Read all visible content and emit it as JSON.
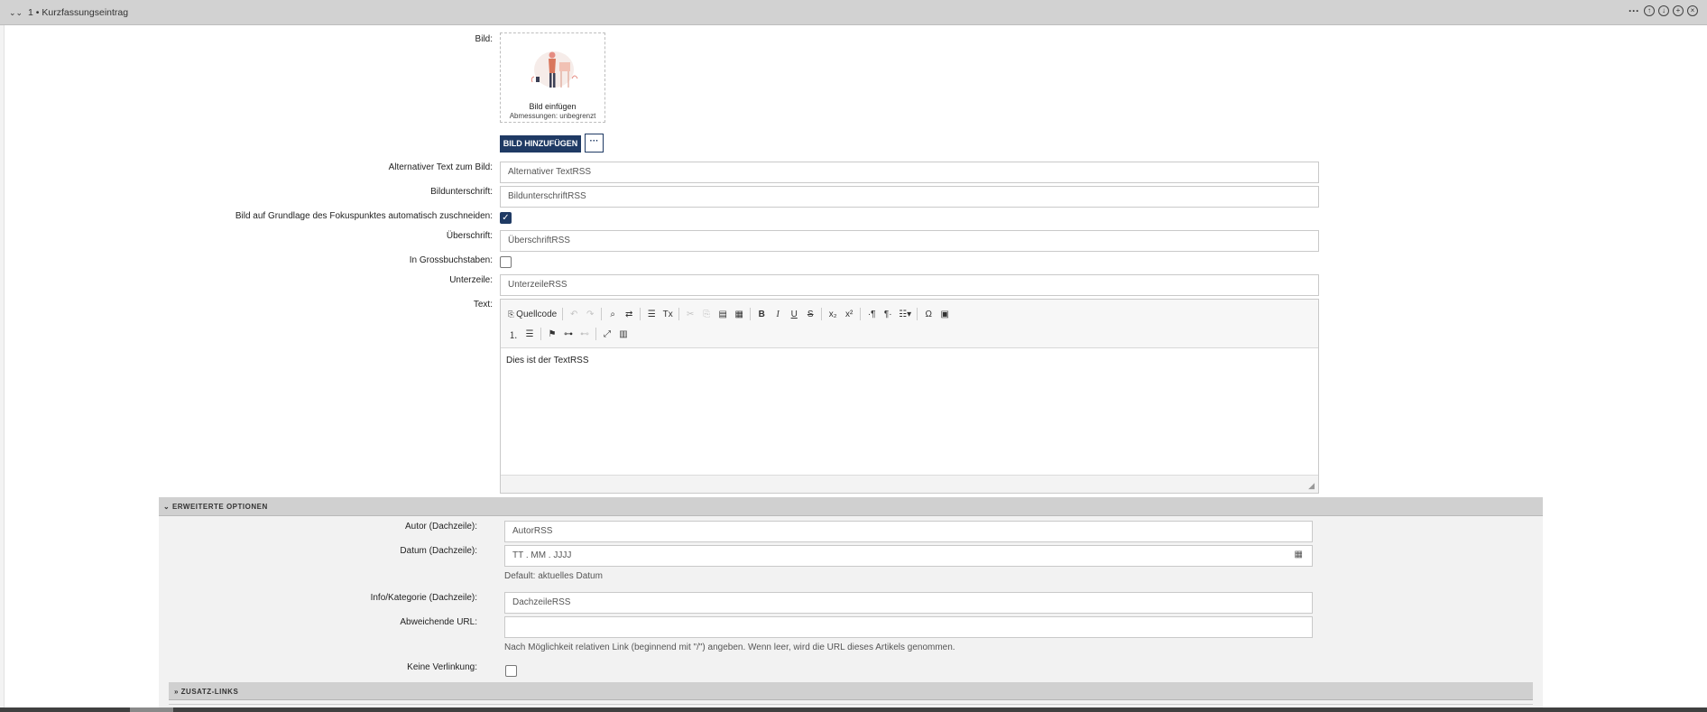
{
  "header": {
    "title": "1 • Kurzfassungseintrag",
    "actions": [
      "more-icon",
      "move-up-icon",
      "move-down-icon",
      "add-icon",
      "close-icon"
    ]
  },
  "form": {
    "bild_label": "Bild:",
    "image_caption": "Bild einfügen",
    "image_dimensions": "Abmessungen: unbegrenzt",
    "add_image_button": "BILD HINZUFÜGEN",
    "more_button": "···",
    "alt_label": "Alternativer Text zum Bild:",
    "alt_value": "Alternativer TextRSS",
    "caption_label": "Bildunterschrift:",
    "caption_value": "BildunterschriftRSS",
    "crop_label": "Bild auf Grundlage des Fokuspunktes automatisch zuschneiden:",
    "crop_checked": true,
    "heading_label": "Überschrift:",
    "heading_value": "ÜberschriftRSS",
    "caps_label": "In Grossbuchstaben:",
    "caps_checked": false,
    "subline_label": "Unterzeile:",
    "subline_value": "UnterzeileRSS",
    "text_label": "Text:",
    "editor": {
      "source_label": "Quellcode",
      "content": "Dies ist der TextRSS"
    }
  },
  "advanced": {
    "title": "ERWEITERTE OPTIONEN",
    "author_label": "Autor (Dachzeile):",
    "author_value": "AutorRSS",
    "date_label": "Datum (Dachzeile):",
    "date_placeholder": "TT . MM . JJJJ",
    "date_hint": "Default: aktuelles Datum",
    "info_label": "Info/Kategorie (Dachzeile):",
    "info_value": "DachzeileRSS",
    "url_label": "Abweichende URL:",
    "url_value": "",
    "url_hint": "Nach Möglichkeit relativen Link (beginnend mit \"/\") angeben. Wenn leer, wird die URL dieses Artikels genommen.",
    "nolink_label": "Keine Verlinkung:",
    "nolink_checked": false,
    "zusatz_title": "ZUSATZ-LINKS"
  },
  "colors": {
    "primary": "#1f3a64",
    "header_bg": "#d2d2d2",
    "panel_bg": "#f2f2f2"
  }
}
